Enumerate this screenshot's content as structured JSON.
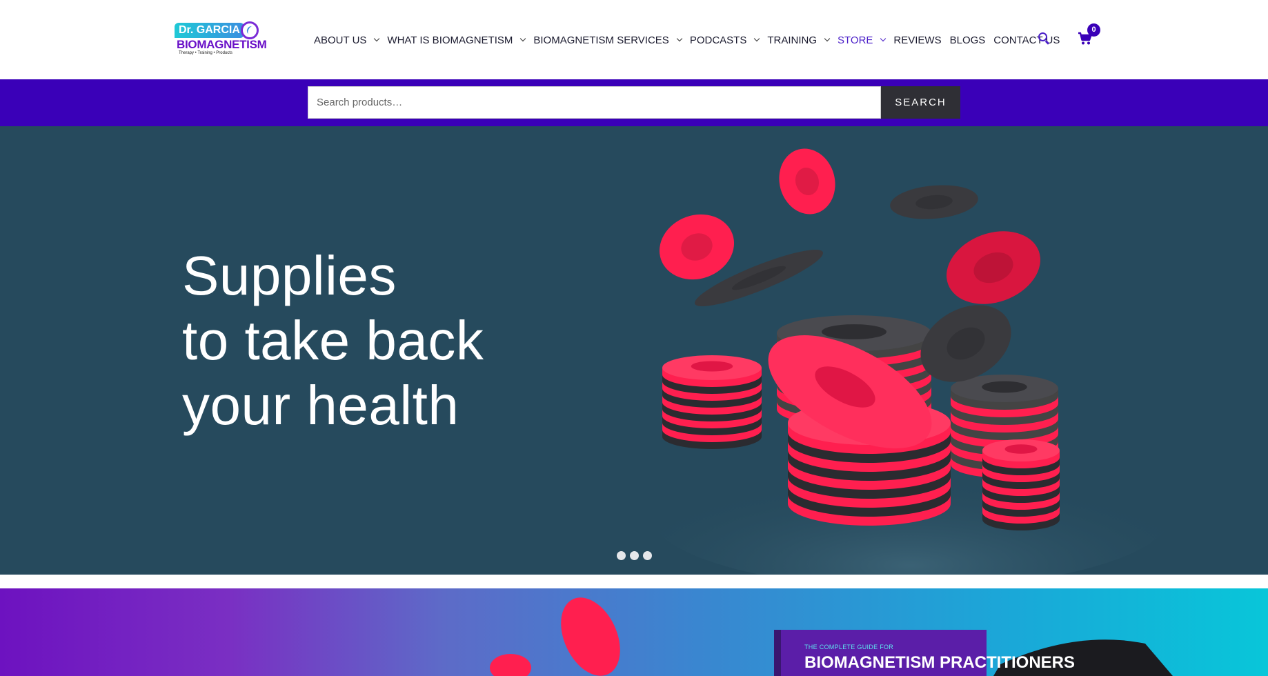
{
  "logo": {
    "line1": "Dr. GARCIA",
    "line2": "BIOMAGNETISM",
    "tagline": "Therapy • Training • Products"
  },
  "nav": {
    "items": [
      {
        "label": "ABOUT US",
        "dropdown": true
      },
      {
        "label": "WHAT IS BIOMAGNETISM",
        "dropdown": true
      },
      {
        "label": "BIOMAGNETISM SERVICES",
        "dropdown": true
      },
      {
        "label": "PODCASTS",
        "dropdown": true
      },
      {
        "label": "TRAINING",
        "dropdown": true
      },
      {
        "label": "STORE",
        "dropdown": true,
        "active": true
      },
      {
        "label": "REVIEWS",
        "dropdown": false
      },
      {
        "label": "BLOGS",
        "dropdown": false
      },
      {
        "label": "CONTACT US",
        "dropdown": false
      }
    ],
    "search_icon": "search-icon",
    "cart_icon": "cart-icon",
    "cart_count": "0"
  },
  "search": {
    "placeholder": "Search products…",
    "button_label": "SEARCH"
  },
  "hero": {
    "title_lines": [
      "Supplies",
      "to take back",
      "your health"
    ],
    "slide_count": 3
  },
  "promo": {
    "book_small": "THE COMPLETE GUIDE FOR",
    "book_title": "BIOMAGNETISM PRACTITIONERS"
  },
  "colors": {
    "brand_purple": "#3a00b8",
    "hero_bg": "#264a5d",
    "magnet_red": "#ff1f4f",
    "magnet_black": "#3a3a3e"
  }
}
